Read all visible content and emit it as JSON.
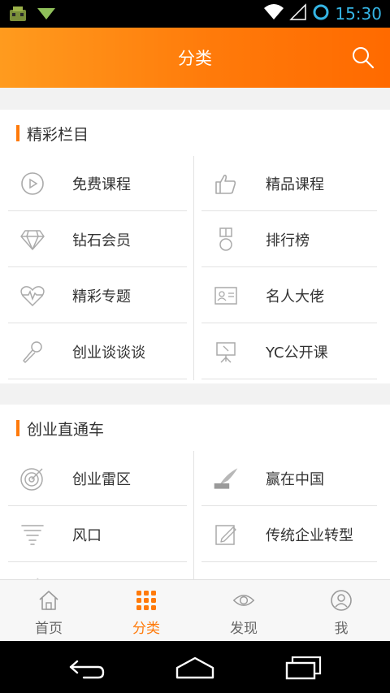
{
  "status_bar": {
    "time": "15:30"
  },
  "header": {
    "title": "分类"
  },
  "section_featured": {
    "title": "精彩栏目",
    "items": [
      {
        "label": "免费课程",
        "icon": "play-circle-icon"
      },
      {
        "label": "精品课程",
        "icon": "thumbs-up-icon"
      },
      {
        "label": "钻石会员",
        "icon": "diamond-icon"
      },
      {
        "label": "排行榜",
        "icon": "medal-icon"
      },
      {
        "label": "精彩专题",
        "icon": "heartbeat-icon"
      },
      {
        "label": "名人大佬",
        "icon": "id-card-icon"
      },
      {
        "label": "创业谈谈谈",
        "icon": "microphone-icon"
      },
      {
        "label": "YC公开课",
        "icon": "presentation-board-icon"
      }
    ]
  },
  "section_startup": {
    "title": "创业直通车",
    "items": [
      {
        "label": "创业雷区",
        "icon": "target-icon"
      },
      {
        "label": "赢在中国",
        "icon": "win-in-china-logo-icon"
      },
      {
        "label": "风口",
        "icon": "tornado-icon"
      },
      {
        "label": "传统企业转型",
        "icon": "edit-doc-icon"
      }
    ]
  },
  "tabs": [
    {
      "label": "首页",
      "icon": "home-icon",
      "active": false
    },
    {
      "label": "分类",
      "icon": "grid-dots-icon",
      "active": true
    },
    {
      "label": "发现",
      "icon": "eye-icon",
      "active": false
    },
    {
      "label": "我",
      "icon": "user-icon",
      "active": false
    }
  ],
  "colors": {
    "accent": "#ff7a0a",
    "icon_gray": "#aaaaaa",
    "time_blue": "#35b5e5"
  }
}
